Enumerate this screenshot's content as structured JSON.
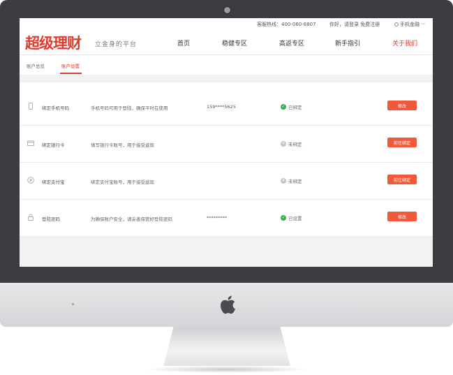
{
  "topbar": {
    "hotline": "客服热线：400-060-8807",
    "login": "你好，请登录 免费注册",
    "mobile": "手机金融"
  },
  "brand": {
    "logo": "超级理财",
    "slogan": "立金身的平台"
  },
  "nav": [
    "首页",
    "稳健专区",
    "高返专区",
    "新手指引",
    "关于我们"
  ],
  "tabs": [
    "账户总览",
    "账户设置"
  ],
  "rows": [
    {
      "icon": "phone-icon",
      "title": "绑定手机号码",
      "desc": "手机号码可用于登陆，确保平时在使用",
      "value": "159****5625",
      "status": "已绑定",
      "status_ok": true,
      "button": "修改"
    },
    {
      "icon": "bank-card-icon",
      "title": "绑定银行卡",
      "desc": "填写银行卡账号，用于接受返现",
      "value": "",
      "status": "未绑定",
      "status_ok": false,
      "button": "前往绑定"
    },
    {
      "icon": "alipay-icon",
      "title": "绑定支付宝",
      "desc": "绑定支付宝账号，用于接受返现",
      "value": "",
      "status": "未绑定",
      "status_ok": false,
      "button": "前往绑定"
    },
    {
      "icon": "lock-icon",
      "title": "登陆密码",
      "desc": "为确保账户安全，请妥善保管好登陆密码",
      "value": "*********",
      "status": "已设置",
      "status_ok": true,
      "button": "修改"
    }
  ],
  "colors": {
    "accent": "#e03a2e",
    "button": "#ef5a3a",
    "ok": "#3bb04a",
    "bezel": "#3c3d41"
  }
}
